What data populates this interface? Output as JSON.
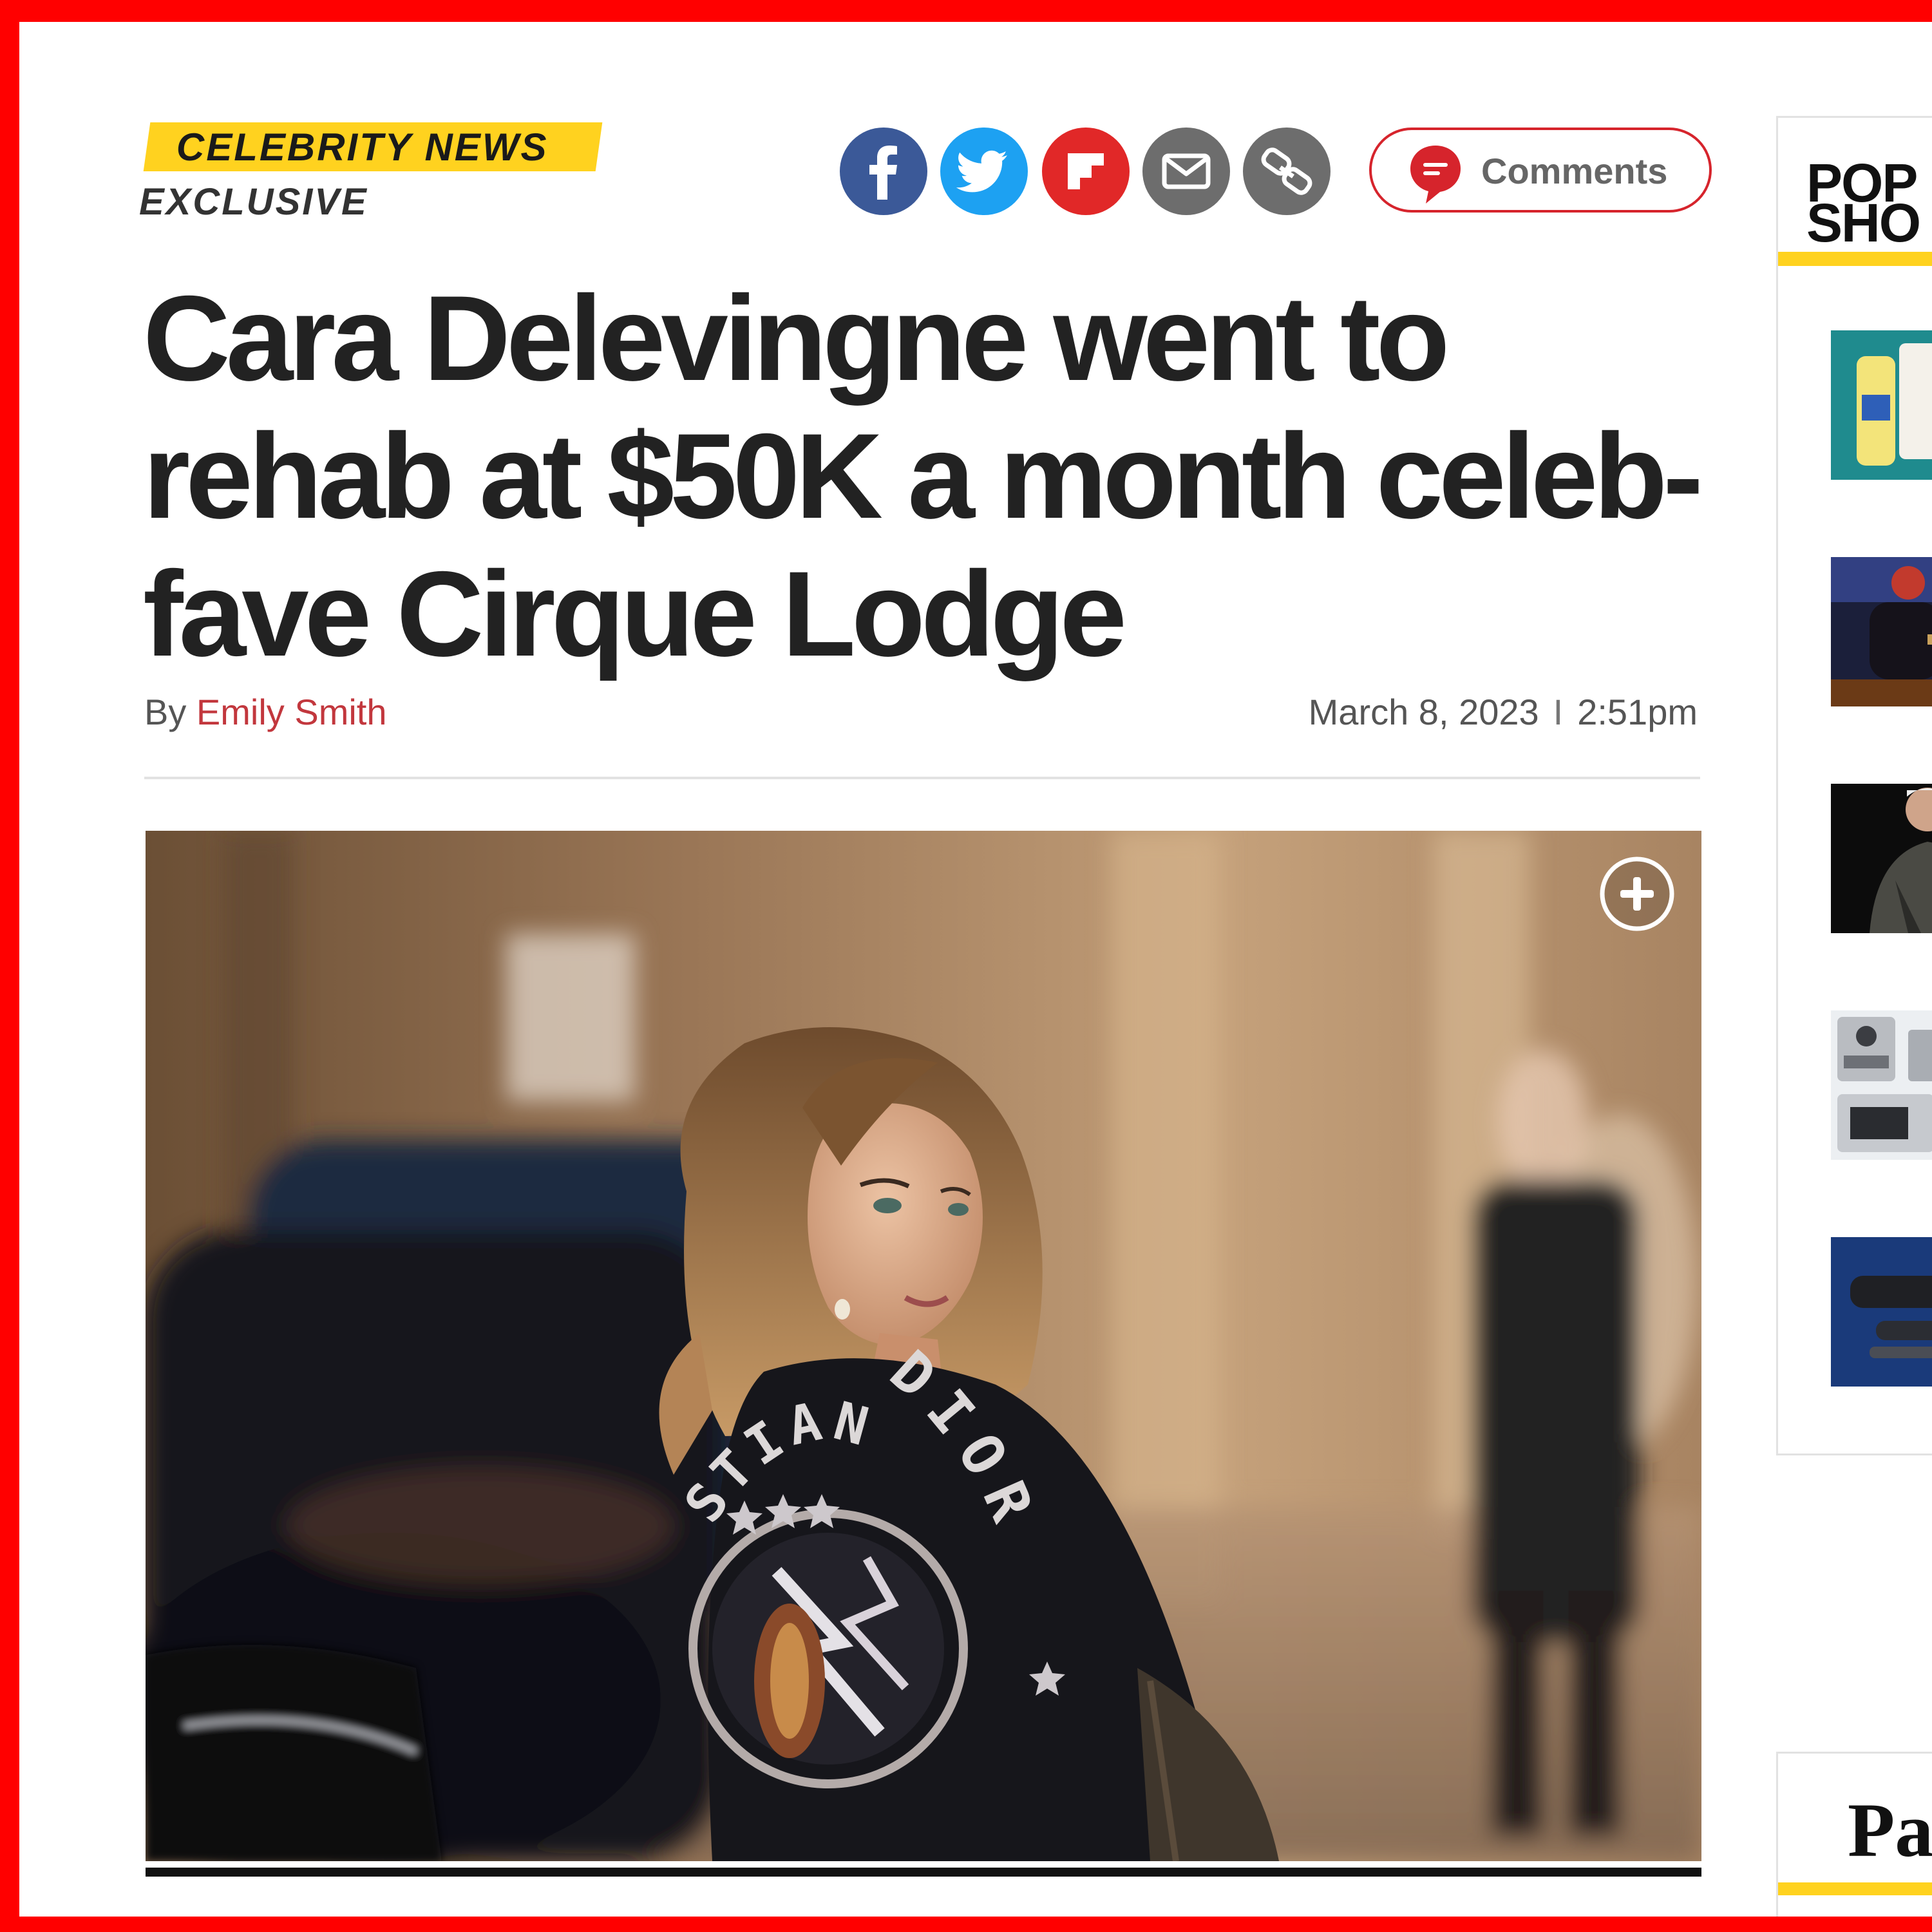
{
  "article": {
    "section": "CELEBRITY NEWS",
    "label": "EXCLUSIVE",
    "headline": "Cara Delevingne went to rehab at $50K a month celeb-fave Cirque Lodge",
    "byline": {
      "prefix": "By",
      "author": "Emily Smith"
    },
    "date": "March 8, 2023",
    "date_separator": "I",
    "time": "2:51pm"
  },
  "share": {
    "icons": [
      "facebook-icon",
      "twitter-icon",
      "flipboard-icon",
      "email-icon",
      "link-icon"
    ],
    "comments_label": "Comments"
  },
  "hero": {
    "jacket_text": {
      "left_arc": "STIAN",
      "right_arc": "DIOR"
    }
  },
  "rail": {
    "title": "POP\nSHO",
    "title_2": "Pa"
  },
  "colors": {
    "frame": "#ff0000",
    "kicker_bg": "#ffd21f",
    "author_link": "#c2373d",
    "comments_border": "#d6242c",
    "facebook": "#3b5998",
    "twitter": "#1da1f2",
    "flipboard": "#e12828",
    "share_gray": "#6d6d6d"
  }
}
